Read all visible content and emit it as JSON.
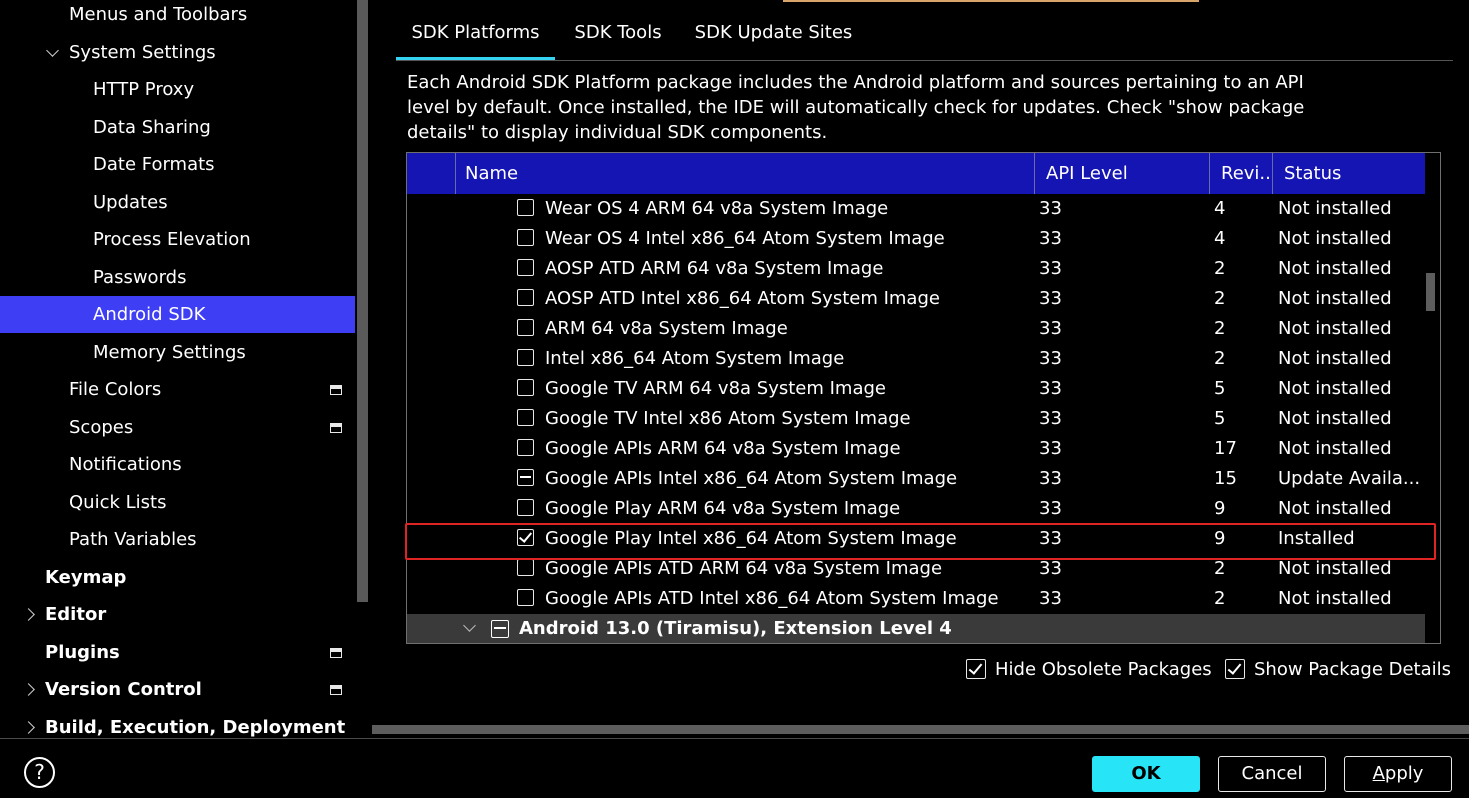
{
  "sidebar": {
    "items": [
      {
        "label": "Menus and Toolbars",
        "level": 1
      },
      {
        "label": "System Settings",
        "level": 1,
        "expander": "down"
      },
      {
        "label": "HTTP Proxy",
        "level": 2
      },
      {
        "label": "Data Sharing",
        "level": 2
      },
      {
        "label": "Date Formats",
        "level": 2
      },
      {
        "label": "Updates",
        "level": 2
      },
      {
        "label": "Process Elevation",
        "level": 2
      },
      {
        "label": "Passwords",
        "level": 2
      },
      {
        "label": "Android SDK",
        "level": 2,
        "selected": true
      },
      {
        "label": "Memory Settings",
        "level": 2
      },
      {
        "label": "File Colors",
        "level": 1,
        "project_icon": true
      },
      {
        "label": "Scopes",
        "level": 1,
        "project_icon": true
      },
      {
        "label": "Notifications",
        "level": 1
      },
      {
        "label": "Quick Lists",
        "level": 1
      },
      {
        "label": "Path Variables",
        "level": 1
      },
      {
        "label": "Keymap",
        "level": 0,
        "bold": true
      },
      {
        "label": "Editor",
        "level": 0,
        "bold": true,
        "expander": "right"
      },
      {
        "label": "Plugins",
        "level": 0,
        "bold": true,
        "project_icon": true
      },
      {
        "label": "Version Control",
        "level": 0,
        "bold": true,
        "expander": "right",
        "project_icon": true
      },
      {
        "label": "Build, Execution, Deployment",
        "level": 0,
        "bold": true,
        "expander": "right"
      }
    ]
  },
  "tabs": [
    {
      "label": "SDK Platforms",
      "active": true
    },
    {
      "label": "SDK Tools",
      "active": false
    },
    {
      "label": "SDK Update Sites",
      "active": false
    }
  ],
  "description": "Each Android SDK Platform package includes the Android platform and sources pertaining to an API level by default. Once installed, the IDE will automatically check for updates. Check \"show package details\" to display individual SDK components.",
  "table": {
    "columns": [
      "Name",
      "API Level",
      "Revi...",
      "Status"
    ],
    "rows": [
      {
        "name": "Wear OS 4 ARM 64 v8a System Image",
        "api": "33",
        "rev": "4",
        "status": "Not installed",
        "check": "none"
      },
      {
        "name": "Wear OS 4 Intel x86_64 Atom System Image",
        "api": "33",
        "rev": "4",
        "status": "Not installed",
        "check": "none"
      },
      {
        "name": "AOSP ATD ARM 64 v8a System Image",
        "api": "33",
        "rev": "2",
        "status": "Not installed",
        "check": "none"
      },
      {
        "name": "AOSP ATD Intel x86_64 Atom System Image",
        "api": "33",
        "rev": "2",
        "status": "Not installed",
        "check": "none"
      },
      {
        "name": "ARM 64 v8a System Image",
        "api": "33",
        "rev": "2",
        "status": "Not installed",
        "check": "none"
      },
      {
        "name": "Intel x86_64 Atom System Image",
        "api": "33",
        "rev": "2",
        "status": "Not installed",
        "check": "none"
      },
      {
        "name": "Google TV ARM 64 v8a System Image",
        "api": "33",
        "rev": "5",
        "status": "Not installed",
        "check": "none"
      },
      {
        "name": "Google TV Intel x86 Atom System Image",
        "api": "33",
        "rev": "5",
        "status": "Not installed",
        "check": "none"
      },
      {
        "name": "Google APIs ARM 64 v8a System Image",
        "api": "33",
        "rev": "17",
        "status": "Not installed",
        "check": "none"
      },
      {
        "name": "Google APIs Intel x86_64 Atom System Image",
        "api": "33",
        "rev": "15",
        "status": "Update Availa...",
        "check": "partial"
      },
      {
        "name": "Google Play ARM 64 v8a System Image",
        "api": "33",
        "rev": "9",
        "status": "Not installed",
        "check": "none"
      },
      {
        "name": "Google Play Intel x86_64 Atom System Image",
        "api": "33",
        "rev": "9",
        "status": "Installed",
        "check": "checked"
      },
      {
        "name": "Google APIs ATD ARM 64 v8a System Image",
        "api": "33",
        "rev": "2",
        "status": "Not installed",
        "check": "none"
      },
      {
        "name": "Google APIs ATD Intel x86_64 Atom System Image",
        "api": "33",
        "rev": "2",
        "status": "Not installed",
        "check": "none"
      }
    ],
    "group_row": "Android 13.0 (Tiramisu), Extension Level 4"
  },
  "options": {
    "hide_obsolete": "Hide Obsolete Packages",
    "show_details": "Show Package Details"
  },
  "footer": {
    "help": "?",
    "ok": "OK",
    "cancel": "Cancel",
    "apply_u": "A",
    "apply_rest": "pply"
  },
  "colors": {
    "selection": "#3e3ef5",
    "header": "#1515b3",
    "tab_underline": "#34d3f2",
    "ok_button": "#27e4f7",
    "highlight_box": "#e02424"
  }
}
